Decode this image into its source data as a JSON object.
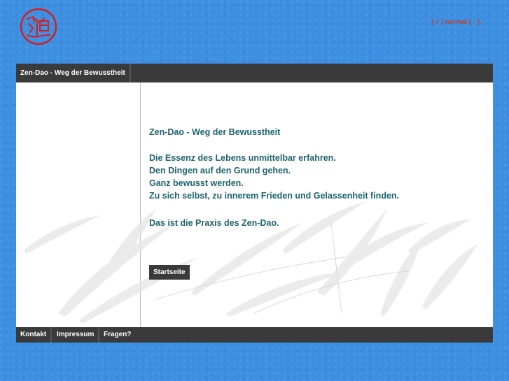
{
  "header": {
    "logo_icon": "red-seal-logo-icon",
    "font_size_plus": "[ + ]",
    "font_size_normal": "normal",
    "font_size_minus": "[ - ]"
  },
  "nav": {
    "title_tab": "Zen-Dao - Weg der Bewusstheit"
  },
  "main": {
    "headline": "Zen-Dao - Weg der Bewusstheit",
    "lines": [
      "Die Essenz des Lebens unmittelbar erfahren.",
      "Den Dingen auf den Grund gehen.",
      "Ganz bewusst werden.",
      "Zu sich selbst, zu innerem Frieden und Gelassenheit finden."
    ],
    "practice": "Das ist die Praxis des Zen-Dao.",
    "start_button": "Startseite"
  },
  "footer": {
    "links": [
      "Kontakt",
      "Impressum",
      "Fragen?"
    ]
  },
  "colors": {
    "background": "#3d8fe2",
    "bar": "#3a3a3a",
    "text": "#1e6470",
    "accent": "#c8372a"
  }
}
